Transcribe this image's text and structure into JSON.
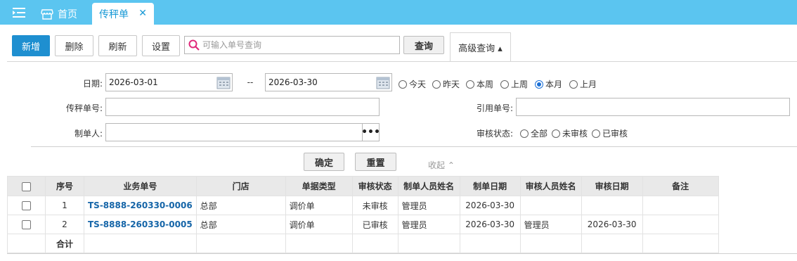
{
  "tabs": {
    "home_label": "首页",
    "active_label": "传秤单",
    "close_glyph": "✕"
  },
  "toolbar": {
    "add_label": "新增",
    "delete_label": "删除",
    "refresh_label": "刷新",
    "settings_label": "设置",
    "search_placeholder": "可输入单号查询",
    "search_value": "",
    "query_label": "查询",
    "advanced_label": "高级查询 ▴"
  },
  "filters": {
    "date_label": "日期:",
    "date_from": "2026-03-01",
    "date_sep": "--",
    "date_to": "2026-03-30",
    "date_presets": [
      "今天",
      "昨天",
      "本周",
      "上周",
      "本月",
      "上月"
    ],
    "date_preset_selected": "本月",
    "order_no_label": "传秤单号:",
    "order_no_value": "",
    "ref_no_label": "引用单号:",
    "ref_no_value": "",
    "creator_label": "制单人:",
    "creator_value": "",
    "creator_btn": "•••",
    "audit_label": "审核状态:",
    "audit_options": [
      "全部",
      "未审核",
      "已审核"
    ],
    "audit_selected": "",
    "confirm_label": "确定",
    "reset_label": "重置",
    "collapse_label": "收起 ⌃"
  },
  "table": {
    "columns": [
      "序号",
      "业务单号",
      "门店",
      "单据类型",
      "审核状态",
      "制单人员姓名",
      "制单日期",
      "审核人员姓名",
      "审核日期",
      "备注"
    ],
    "rows": [
      [
        "1",
        "TS-8888-260330-0006",
        "总部",
        "调价单",
        "未审核",
        "管理员",
        "2026-03-30",
        "",
        "",
        ""
      ],
      [
        "2",
        "TS-8888-260330-0005",
        "总部",
        "调价单",
        "已审核",
        "管理员",
        "2026-03-30",
        "管理员",
        "2026-03-30",
        ""
      ]
    ],
    "total_label": "合计"
  },
  "colors": {
    "topbar": "#5bc5f0",
    "primary": "#1e8fd0",
    "link": "#1565a8"
  }
}
